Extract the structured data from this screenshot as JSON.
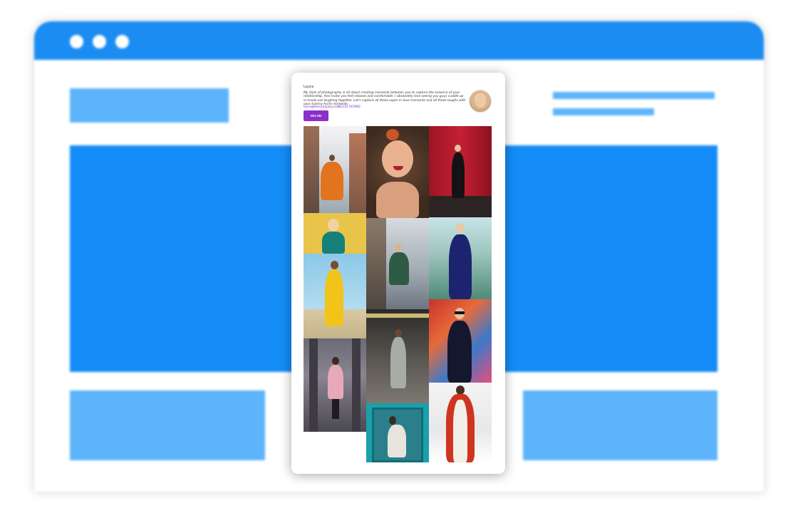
{
  "profile": {
    "name": "Laura",
    "bio": "My style of photography is all about creating moments between you to capture the essence of your relationship. And make you feel relaxed and comfortable. I absolutely love seeing you guys cuddle up or break out laughing together. Let's capture all those super in love moments and all those laughs with your tummy-hurts moments.",
    "email": "laura@thecompany.com",
    "phone": "01234 567890",
    "hire_label": "Hire Me"
  },
  "gallery": [
    {
      "subject": "woman-in-orange-dress-city-street"
    },
    {
      "subject": "redhead-woman-smiling-portrait"
    },
    {
      "subject": "woman-in-black-red-wall"
    },
    {
      "subject": "woman-with-sunglasses-yellow"
    },
    {
      "subject": "woman-blue-sky-buildings"
    },
    {
      "subject": "woman-navy-dress-plants"
    },
    {
      "subject": "woman-yellow-tracksuit-beach"
    },
    {
      "subject": "woman-jumpsuit-street-night"
    },
    {
      "subject": "woman-sunglasses-graffiti"
    },
    {
      "subject": "woman-pink-coat-arcade"
    },
    {
      "subject": "woman-teal-door"
    },
    {
      "subject": "woman-red-coat-snow"
    }
  ],
  "colors": {
    "browser_bar": "#1a8cf2",
    "placeholder_light": "#5db4fb",
    "placeholder_dark": "#148cf7",
    "accent": "#8b2fc9"
  }
}
